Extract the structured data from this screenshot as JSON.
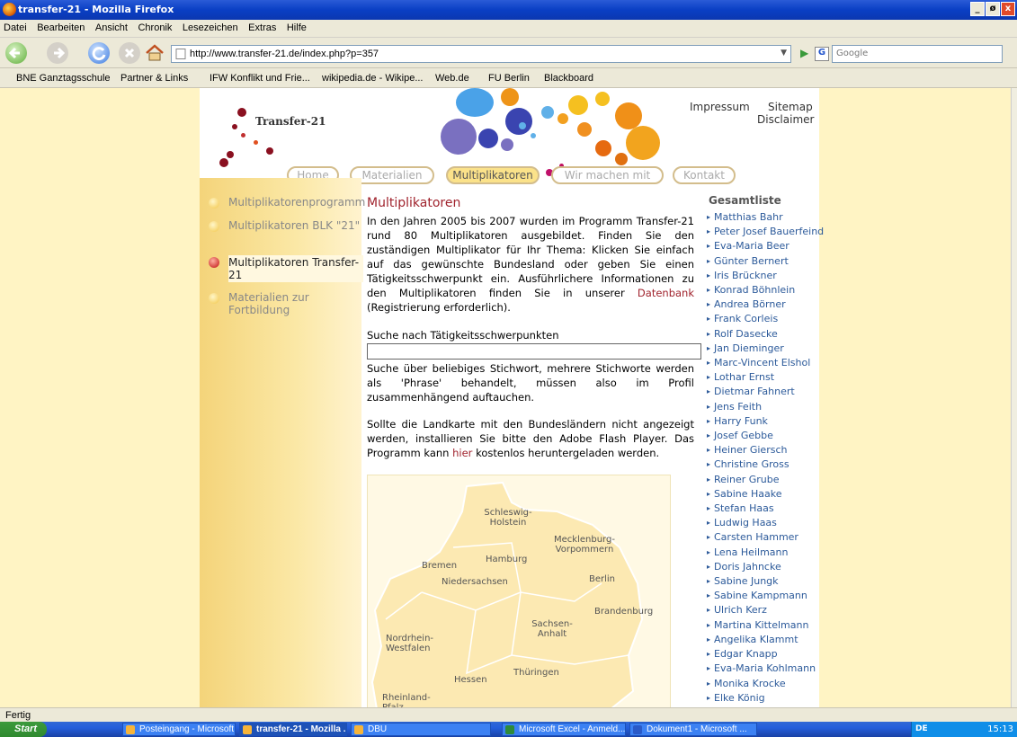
{
  "window": {
    "title": "transfer-21 - Mozilla Firefox",
    "min": "_",
    "max": "ø",
    "close": "x"
  },
  "menu": [
    "Datei",
    "Bearbeiten",
    "Ansicht",
    "Chronik",
    "Lesezeichen",
    "Extras",
    "Hilfe"
  ],
  "nav": {
    "url": "http://www.transfer-21.de/index.php?p=357",
    "search_placeholder": "Google"
  },
  "bookmarks": [
    "BNE Ganztagsschule",
    "Partner & Links",
    "IFW Konflikt und Frie...",
    "wikipedia.de - Wikipe...",
    "Web.de",
    "FU Berlin",
    "Blackboard"
  ],
  "site": {
    "logo": "Transfer-21",
    "top_links": [
      "Impressum",
      "Sitemap",
      "Disclaimer"
    ],
    "tabs": [
      "Home",
      "Materialien",
      "Multiplikatoren",
      "Wir machen mit",
      "Kontakt"
    ],
    "left_nav": [
      {
        "label": "Multiplikatorenprogramm",
        "active": false
      },
      {
        "label": "Multiplikatoren BLK \"21\"",
        "active": false
      },
      {
        "label": "Multiplikatoren Transfer-21",
        "active": true
      },
      {
        "label": "Materialien zur Fortbildung",
        "active": false
      }
    ],
    "heading": "Multiplikatoren",
    "intro_pre": "In den Jahren 2005 bis 2007 wurden im Programm Transfer-21 rund 80 Multiplikatoren ausgebildet. Finden Sie den zuständigen Multiplikator für Ihr Thema: Klicken Sie einfach auf das gewünschte Bundesland oder geben Sie einen Tätigkeitsschwerpunkt ein. Ausführlichere Informationen zu den Multiplikatoren finden Sie in unserer ",
    "intro_link": "Datenbank",
    "intro_post": " (Registrierung erforderlich).",
    "search_label": "Suche nach Tätigkeitsschwerpunkten",
    "search_value": "",
    "search_help": "Suche über beliebiges Stichwort, mehrere Stichworte werden als 'Phrase' behandelt, müssen also im Profil zusammenhängend auftauchen.",
    "flash_pre": "Sollte die Landkarte mit den Bundesländern nicht angezeigt werden, installieren Sie bitte den Adobe Flash Player. Das Programm kann ",
    "flash_link": "hier",
    "flash_post": " kostenlos heruntergeladen werden.",
    "map_labels": [
      "Schleswig-Holstein",
      "Mecklenburg-Vorpommern",
      "Hamburg",
      "Bremen",
      "Niedersachsen",
      "Berlin",
      "Brandenburg",
      "Sachsen-Anhalt",
      "Nordrhein-Westfalen",
      "Thüringen",
      "Hessen",
      "Rheinland-Pfalz"
    ],
    "list_title": "Gesamtliste",
    "list": [
      "Matthias Bahr",
      "Peter Josef Bauerfeind",
      "Eva-Maria Beer",
      "Günter Bernert",
      "Iris Brückner",
      "Konrad Böhnlein",
      "Andrea Börner",
      "Frank Corleis",
      "Rolf Dasecke",
      "Jan Dieminger",
      "Marc-Vincent Elshol",
      "Lothar Ernst",
      "Dietmar Fahnert",
      "Jens Feith",
      "Harry Funk",
      "Josef Gebbe",
      "Heiner Giersch",
      "Christine Gross",
      "Reiner Grube",
      "Sabine Haake",
      "Stefan Haas",
      "Ludwig Haas",
      "Carsten Hammer",
      "Lena Heilmann",
      "Doris Jahncke",
      "Sabine Jungk",
      "Sabine Kampmann",
      "Ulrich Kerz",
      "Martina Kittelmann",
      "Angelika Klammt",
      "Edgar Knapp",
      "Eva-Maria Kohlmann",
      "Monika Krocke",
      "Elke König"
    ]
  },
  "status": "Fertig",
  "taskbar": {
    "start": "Start",
    "items": [
      "Posteingang - Microsoft ...",
      "transfer-21 - Mozilla ...",
      "DBU",
      "Microsoft Excel - Anmeld...",
      "Dokument1 - Microsoft ..."
    ],
    "clock": "15:13",
    "lang": "DE"
  }
}
